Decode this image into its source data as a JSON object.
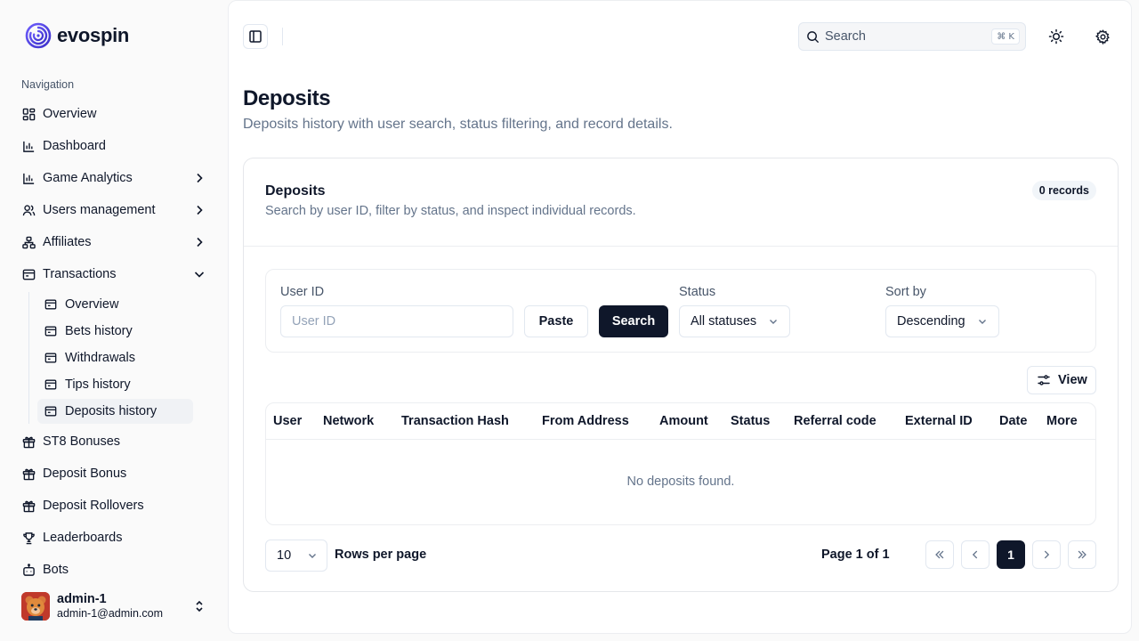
{
  "brand": {
    "name": "evospin"
  },
  "sidebar": {
    "heading": "Navigation",
    "items": [
      {
        "label": "Overview",
        "icon": "layout-grid-icon"
      },
      {
        "label": "Dashboard",
        "icon": "bar-chart-icon"
      },
      {
        "label": "Game Analytics",
        "icon": "bar-chart-icon",
        "expandable": true
      },
      {
        "label": "Users management",
        "icon": "users-icon",
        "expandable": true
      },
      {
        "label": "Affiliates",
        "icon": "network-icon",
        "expandable": true
      },
      {
        "label": "Transactions",
        "icon": "wallet-icon",
        "expanded": true
      }
    ],
    "sub_items": [
      {
        "label": "Overview"
      },
      {
        "label": "Bets history"
      },
      {
        "label": "Withdrawals"
      },
      {
        "label": "Tips history"
      },
      {
        "label": "Deposits history",
        "active": true
      }
    ],
    "items_after": [
      {
        "label": "ST8 Bonuses",
        "icon": "gift-icon"
      },
      {
        "label": "Deposit Bonus",
        "icon": "gift-icon"
      },
      {
        "label": "Deposit Rollovers",
        "icon": "gift-icon"
      },
      {
        "label": "Leaderboards",
        "icon": "trophy-icon"
      },
      {
        "label": "Bots",
        "icon": "bot-icon"
      }
    ],
    "user": {
      "name": "admin-1",
      "email": "admin-1@admin.com"
    }
  },
  "topbar": {
    "search_placeholder": "Search",
    "shortcut": "⌘ K"
  },
  "page": {
    "title": "Deposits",
    "subtitle": "Deposits history with user search, status filtering, and record details."
  },
  "card": {
    "title": "Deposits",
    "subtitle": "Search by user ID, filter by status, and inspect individual records.",
    "badge": "0 records"
  },
  "filters": {
    "user_id_label": "User ID",
    "user_id_placeholder": "User ID",
    "paste_label": "Paste",
    "search_label": "Search",
    "status_label": "Status",
    "status_value": "All statuses",
    "sort_label": "Sort by",
    "sort_value": "Descending"
  },
  "view_label": "View",
  "table": {
    "columns": [
      "User",
      "Network",
      "Transaction Hash",
      "From Address",
      "Amount",
      "Status",
      "Referral code",
      "External ID",
      "Date",
      "More"
    ],
    "empty_text": "No deposits found."
  },
  "pagination": {
    "rows_value": "10",
    "rows_label": "Rows per page",
    "page_info": "Page 1 of 1",
    "current_page": "1"
  },
  "colors": {
    "primary": "#0f172a",
    "muted": "#64748b",
    "border": "#e2e8f0",
    "brand": "#4f46e5"
  }
}
